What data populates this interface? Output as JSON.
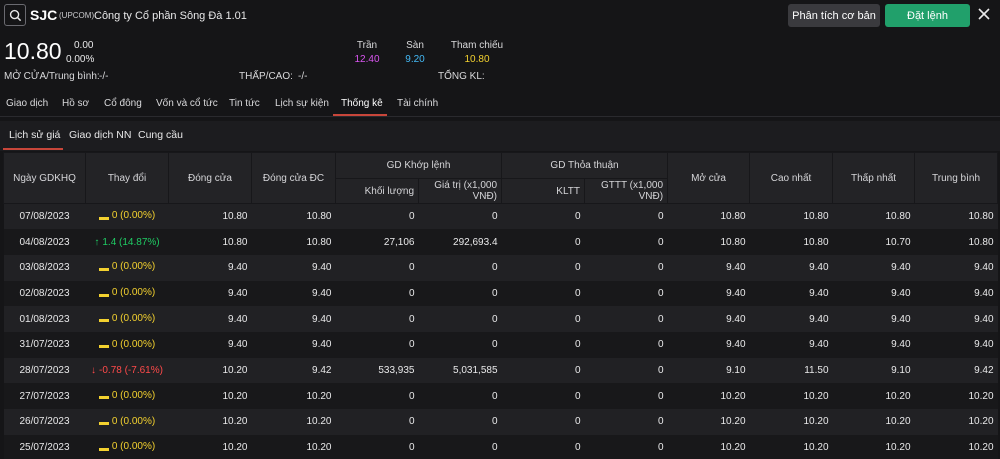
{
  "header": {
    "symbol": "SJC",
    "exchange": "(UPCOM)",
    "company": "Công ty Cổ phần Sông Đà 1.01",
    "btn_analysis": "Phân tích cơ bản",
    "btn_order": "Đặt lệnh"
  },
  "quote": {
    "price": "10.80",
    "change": "0.00",
    "change_pct": "0.00%",
    "ceiling_label": "Trần",
    "ceiling": "12.40",
    "floor_label": "Sàn",
    "floor": "9.20",
    "ref_label": "Tham chiếu",
    "ref": "10.80",
    "open_avg_label": "MỞ CỬA/Trung bình:",
    "open_avg": "-/-",
    "low_high_label": "THẤP/CAO:",
    "low_high": "-/-",
    "total_vol_label": "TỔNG KL:",
    "colors": {
      "ceiling": "#d955f0",
      "floor": "#43b8f4",
      "ref": "#f3d12f",
      "accent": "#21a06b",
      "tab_active": "#c8463a"
    }
  },
  "tabs": [
    "Giao dịch",
    "Hồ sơ",
    "Cổ đông",
    "Vốn và cổ tức",
    "Tin tức",
    "Lịch sự kiện",
    "Thống kê",
    "Tài chính"
  ],
  "active_tab": "Thống kê",
  "subtabs": [
    "Lịch sử giá",
    "Giao dịch NN",
    "Cung cầu"
  ],
  "active_subtab": "Lịch sử giá",
  "table": {
    "col_date": "Ngày GDKHQ",
    "col_change": "Thay đổi",
    "col_close": "Đóng cửa",
    "col_adj_close": "Đóng cửa ĐC",
    "group_matched": "GD Khớp lệnh",
    "group_deal": "GD Thỏa thuận",
    "col_volume": "Khối lượng",
    "col_value": "Giá trị (x1,000 VNĐ)",
    "col_deal_vol": "KLTT",
    "col_deal_val": "GTTT (x1,000 VNĐ)",
    "col_open": "Mở cửa",
    "col_high": "Cao nhất",
    "col_low": "Thấp nhất",
    "col_avg": "Trung bình",
    "rows": [
      {
        "date": "07/08/2023",
        "dir": "flat",
        "change": "0 (0.00%)",
        "close": "10.80",
        "adj": "10.80",
        "vol": "0",
        "val": "0",
        "dvol": "0",
        "dval": "0",
        "open": "10.80",
        "high": "10.80",
        "low": "10.80",
        "avg": "10.80"
      },
      {
        "date": "04/08/2023",
        "dir": "up",
        "change": "1.4 (14.87%)",
        "close": "10.80",
        "adj": "10.80",
        "vol": "27,106",
        "val": "292,693.4",
        "dvol": "0",
        "dval": "0",
        "open": "10.80",
        "high": "10.80",
        "low": "10.70",
        "avg": "10.80"
      },
      {
        "date": "03/08/2023",
        "dir": "flat",
        "change": "0 (0.00%)",
        "close": "9.40",
        "adj": "9.40",
        "vol": "0",
        "val": "0",
        "dvol": "0",
        "dval": "0",
        "open": "9.40",
        "high": "9.40",
        "low": "9.40",
        "avg": "9.40"
      },
      {
        "date": "02/08/2023",
        "dir": "flat",
        "change": "0 (0.00%)",
        "close": "9.40",
        "adj": "9.40",
        "vol": "0",
        "val": "0",
        "dvol": "0",
        "dval": "0",
        "open": "9.40",
        "high": "9.40",
        "low": "9.40",
        "avg": "9.40"
      },
      {
        "date": "01/08/2023",
        "dir": "flat",
        "change": "0 (0.00%)",
        "close": "9.40",
        "adj": "9.40",
        "vol": "0",
        "val": "0",
        "dvol": "0",
        "dval": "0",
        "open": "9.40",
        "high": "9.40",
        "low": "9.40",
        "avg": "9.40"
      },
      {
        "date": "31/07/2023",
        "dir": "flat",
        "change": "0 (0.00%)",
        "close": "9.40",
        "adj": "9.40",
        "vol": "0",
        "val": "0",
        "dvol": "0",
        "dval": "0",
        "open": "9.40",
        "high": "9.40",
        "low": "9.40",
        "avg": "9.40"
      },
      {
        "date": "28/07/2023",
        "dir": "down",
        "change": "-0.78 (-7.61%)",
        "close": "10.20",
        "adj": "9.42",
        "vol": "533,935",
        "val": "5,031,585",
        "dvol": "0",
        "dval": "0",
        "open": "9.10",
        "high": "11.50",
        "low": "9.10",
        "avg": "9.42"
      },
      {
        "date": "27/07/2023",
        "dir": "flat",
        "change": "0 (0.00%)",
        "close": "10.20",
        "adj": "10.20",
        "vol": "0",
        "val": "0",
        "dvol": "0",
        "dval": "0",
        "open": "10.20",
        "high": "10.20",
        "low": "10.20",
        "avg": "10.20"
      },
      {
        "date": "26/07/2023",
        "dir": "flat",
        "change": "0 (0.00%)",
        "close": "10.20",
        "adj": "10.20",
        "vol": "0",
        "val": "0",
        "dvol": "0",
        "dval": "0",
        "open": "10.20",
        "high": "10.20",
        "low": "10.20",
        "avg": "10.20"
      },
      {
        "date": "25/07/2023",
        "dir": "flat",
        "change": "0 (0.00%)",
        "close": "10.20",
        "adj": "10.20",
        "vol": "0",
        "val": "0",
        "dvol": "0",
        "dval": "0",
        "open": "10.20",
        "high": "10.20",
        "low": "10.20",
        "avg": "10.20"
      }
    ]
  }
}
